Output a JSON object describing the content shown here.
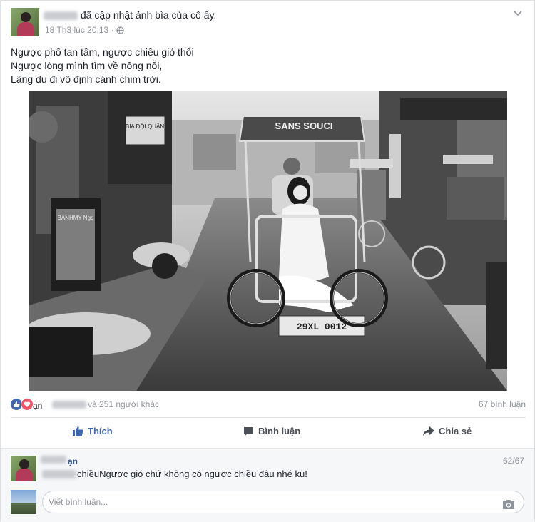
{
  "post": {
    "header_text": "đã cập nhật ảnh bìa của cô ấy.",
    "timestamp": "18 Th3 lúc 20:13",
    "separator": "·",
    "privacy_icon": "globe-icon",
    "lines": [
      "Ngược phố tan tầm, ngược chiều gió thổi",
      "Ngược lòng mình tìm về nông nỗi,",
      "Lãng du đi vô định cánh chim trời."
    ],
    "photo": {
      "shop_sign": "SANS SOUCI",
      "plate": "29XL 0012",
      "poster_title": "BANHMY Ngọ",
      "store_sign": "BIA ĐỘI QUÂN"
    }
  },
  "stats": {
    "likes_suffix": "và 251 người khác",
    "comments_count": "67 bình luận",
    "name_fragment": "ạn"
  },
  "actions": {
    "like": "Thích",
    "comment": "Bình luận",
    "share": "Chia sẻ"
  },
  "comments": {
    "pager": "62/67",
    "first": {
      "author_fragment": "ạn",
      "text": "chiềuNgược gió chứ không có ngược chiều đâu nhé ku!"
    },
    "input_placeholder": "Viết bình luận..."
  },
  "colors": {
    "brand_blue": "#4267b2",
    "love_red": "#f25268",
    "muted": "#90949c"
  }
}
